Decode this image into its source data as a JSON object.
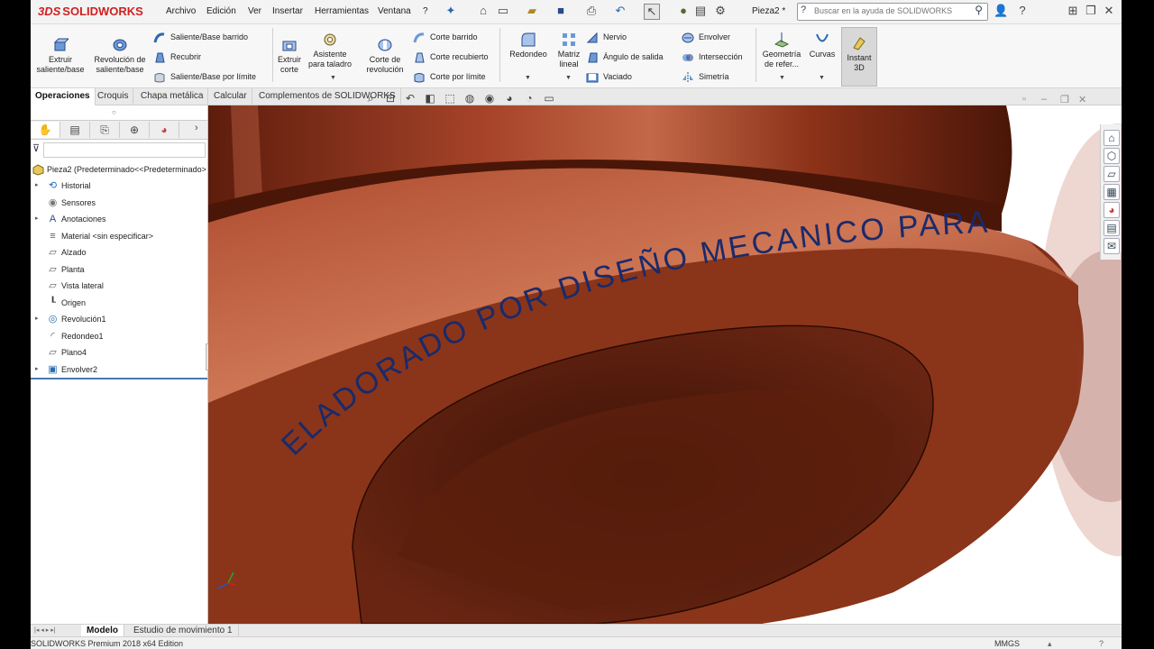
{
  "app": {
    "brand": "SOLIDWORKS",
    "brand_prefix": "3DS"
  },
  "menu": [
    "Archivo",
    "Edición",
    "Ver",
    "Insertar",
    "Herramientas",
    "Ventana",
    "?"
  ],
  "document_title": "Pieza2 *",
  "search": {
    "placeholder": "Buscar en la ayuda de SOLIDWORKS"
  },
  "commands": {
    "extrude_boss": "Extruir saliente/base",
    "revolve_boss": "Revolución de saliente/base",
    "swept_boss": "Saliente/Base barrido",
    "loft_boss": "Recubrir",
    "boundary_boss": "Saliente/Base por límite",
    "extrude_cut": "Extruir corte",
    "hole_wizard": "Asistente para taladro",
    "revolve_cut": "Corte de revolución",
    "swept_cut": "Corte barrido",
    "loft_cut": "Corte recubierto",
    "boundary_cut": "Corte por límite",
    "fillet": "Redondeo",
    "linear_pattern": "Matriz lineal",
    "rib": "Nervio",
    "draft": "Ángulo de salida",
    "shell": "Vaciado",
    "wrap": "Envolver",
    "intersect": "Intersección",
    "mirror": "Simetría",
    "ref_geometry": "Geometría de refer...",
    "curves": "Curvas",
    "instant3d": "Instant 3D"
  },
  "tabs": [
    "Operaciones",
    "Croquis",
    "Chapa metálica",
    "Calcular",
    "Complementos de SOLIDWORKS"
  ],
  "tree": {
    "root": "Pieza2  (Predeterminado<<Predeterminado>",
    "items": [
      {
        "label": "Historial",
        "icon": "history-icon",
        "expandable": true
      },
      {
        "label": "Sensores",
        "icon": "sensor-icon",
        "expandable": false
      },
      {
        "label": "Anotaciones",
        "icon": "annotation-icon",
        "expandable": true
      },
      {
        "label": "Material <sin especificar>",
        "icon": "material-icon",
        "expandable": false
      },
      {
        "label": "Alzado",
        "icon": "plane-icon",
        "expandable": false
      },
      {
        "label": "Planta",
        "icon": "plane-icon",
        "expandable": false
      },
      {
        "label": "Vista lateral",
        "icon": "plane-icon",
        "expandable": false
      },
      {
        "label": "Origen",
        "icon": "origin-icon",
        "expandable": false
      },
      {
        "label": "Revolución1",
        "icon": "revolve-icon",
        "expandable": true
      },
      {
        "label": "Redondeo1",
        "icon": "fillet-icon",
        "expandable": false
      },
      {
        "label": "Plano4",
        "icon": "plane-icon",
        "expandable": false
      },
      {
        "label": "Envolver2",
        "icon": "wrap-icon",
        "expandable": true
      }
    ]
  },
  "model_text": "ELADORADO POR DISEÑO MECANICO PARA TI",
  "bottom_tabs": [
    "Modelo",
    "Estudio de movimiento 1"
  ],
  "status": {
    "left": "SOLIDWORKS Premium 2018 x64 Edition",
    "units": "MMGS"
  },
  "colors": {
    "brand_red": "#d02020",
    "part": "#9a3a20",
    "text_engraving": "#1a2a6a",
    "selection_blue": "#4a78b5"
  }
}
